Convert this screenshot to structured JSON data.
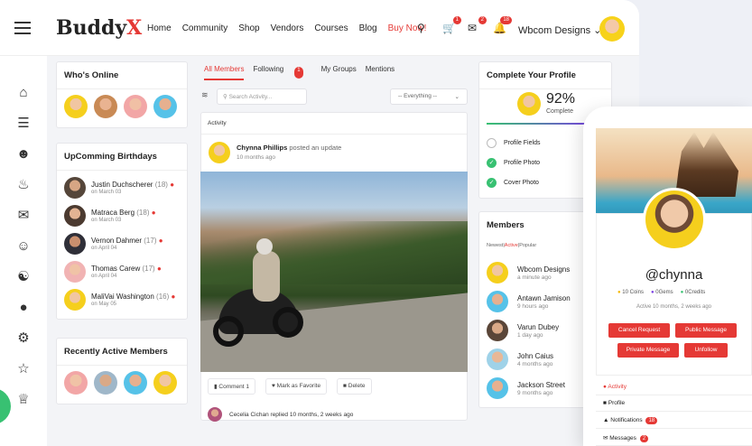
{
  "header": {
    "logo_main": "Buddy",
    "logo_accent": "X",
    "nav": [
      "Home",
      "Community",
      "Shop",
      "Vendors",
      "Courses",
      "Blog"
    ],
    "buy_now": "Buy Now!",
    "cart_count": "1",
    "mail_count": "2",
    "notif_count": "18",
    "user_name": "Wbcom Designs"
  },
  "whos_online": {
    "title": "Who's Online"
  },
  "birthdays": {
    "title": "UpComming Birthdays",
    "items": [
      {
        "name": "Justin Duchscherer",
        "age": "(18)",
        "date": "on March 03"
      },
      {
        "name": "Matraca Berg",
        "age": "(18)",
        "date": "on March 03"
      },
      {
        "name": "Vernon Dahmer",
        "age": "(17)",
        "date": "on April 04"
      },
      {
        "name": "Thomas Carew",
        "age": "(17)",
        "date": "on April 04"
      },
      {
        "name": "MaliVai Washington",
        "age": "(16)",
        "date": "on May 05"
      }
    ]
  },
  "recent_members": {
    "title": "Recently Active Members"
  },
  "activity": {
    "tabs": {
      "all": "All Members",
      "following": "Following",
      "following_count": "1",
      "groups": "My Groups",
      "mentions": "Mentions"
    },
    "search_placeholder": "Search Activity...",
    "filter": "-- Everything --",
    "section_label": "Activity",
    "post_author": "Chynna Phillips",
    "post_action": "posted an update",
    "post_time": "10 months ago",
    "comment_btn": "Comment",
    "comment_count": "1",
    "favorite_btn": "Mark as Favorite",
    "delete_btn": "Delete",
    "next_author": "Cecelia Cichan",
    "next_text": "replied 10 months, 2 weeks ago"
  },
  "profile_complete": {
    "title": "Complete Your Profile",
    "percent": "92%",
    "percent_value": 92,
    "label": "Complete",
    "items": [
      {
        "label": "Profile Fields",
        "done": false
      },
      {
        "label": "Profile Photo",
        "done": true
      },
      {
        "label": "Cover Photo",
        "done": true
      }
    ]
  },
  "members": {
    "title": "Members",
    "filters": {
      "newest": "Newest",
      "sep1": "|",
      "active": "Active",
      "sep2": "|",
      "popular": "Popular"
    },
    "items": [
      {
        "name": "Wbcom Designs",
        "time": "a minute ago"
      },
      {
        "name": "Antawn Jamison",
        "time": "9 hours ago"
      },
      {
        "name": "Varun Dubey",
        "time": "1 day ago"
      },
      {
        "name": "John Caius",
        "time": "4 months ago"
      },
      {
        "name": "Jackson Street",
        "time": "9 months ago"
      }
    ]
  },
  "mobile": {
    "handle": "@chynna",
    "coins": "10 Coins",
    "gems": "0Gems",
    "credits": "0Credits",
    "active": "Active 10 months, 2 weeks ago",
    "cancel_request": "Cancel Request",
    "public_message": "Public Message",
    "private_message": "Private Message",
    "unfollow": "Unfollow",
    "menu": [
      {
        "label": "Activity",
        "count": ""
      },
      {
        "label": "Profile",
        "count": ""
      },
      {
        "label": "Notifications",
        "count": "18"
      },
      {
        "label": "Messages",
        "count": "2"
      }
    ]
  },
  "colors": {
    "accent": "#e53935",
    "success": "#38c172",
    "progress": "#7b3fe4"
  }
}
